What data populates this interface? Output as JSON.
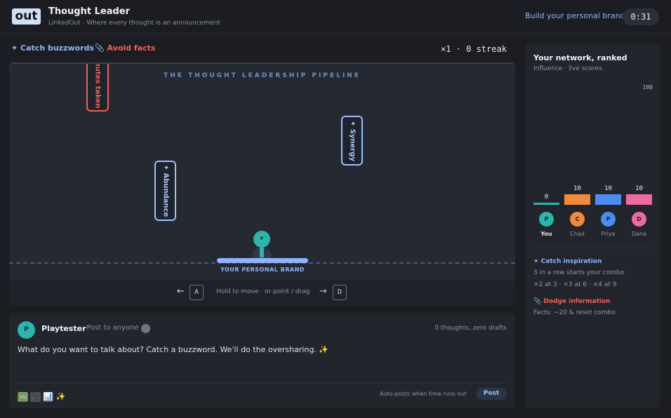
{
  "header": {
    "logo": "out",
    "title": "Thought Leader",
    "subtitle": "LinkedOut · Where every thought is an announcement",
    "brand_link": "Build your personal brand",
    "timer": "0:31"
  },
  "goals": {
    "catch": "✦ Catch buzzwords",
    "separator": "/",
    "avoid": "📎 Avoid facts",
    "streak": "×1 · 0 streak"
  },
  "game": {
    "pipeline_title": "THE THOUGHT LEADERSHIP PIPELINE",
    "falling_words": [
      {
        "text": "nutes taken",
        "kind": "fact"
      },
      {
        "text": "✦ Synergy",
        "kind": "buzzword"
      },
      {
        "text": "✦ Abundance",
        "kind": "buzzword"
      }
    ],
    "player_initial": "P",
    "paddle_label": "YOUR PERSONAL BRAND"
  },
  "controls": {
    "left_arrow": "←",
    "left_key": "A",
    "hint": "Hold to move · or point / drag",
    "right_arrow": "→",
    "right_key": "D"
  },
  "composer": {
    "avatar": "P",
    "name": "Playtester",
    "audience": "· Post to anyone",
    "count": "0 thoughts, zero drafts",
    "prompt": "What do you want to talk about? Catch a buzzword. We'll do the oversharing. ✨",
    "tools": [
      "🖼",
      "🎥",
      "📊",
      "✨"
    ],
    "autopost": "Auto-posts when time runs out",
    "post_label": "Post"
  },
  "sidebar": {
    "title": "Your network, ranked",
    "subtitle": "Influence · live scores",
    "max_label": "100",
    "max_value": 100,
    "players": [
      {
        "initial": "P",
        "name": "You",
        "score": 0,
        "score_label": "0",
        "color": "#2bb5ac"
      },
      {
        "initial": "C",
        "name": "Chad",
        "score": 10,
        "score_label": "10",
        "color": "#f08a3c"
      },
      {
        "initial": "P",
        "name": "Priya",
        "score": 10,
        "score_label": "10",
        "color": "#4b8df0"
      },
      {
        "initial": "D",
        "name": "Dana",
        "score": 10,
        "score_label": "10",
        "color": "#ec6aa3"
      }
    ],
    "rules": {
      "catch_title": "✦ Catch inspiration",
      "catch_line1": "3 in a row starts your combo",
      "catch_line2": "×2 at 3 · ×3 at 6 · ×4 at 9",
      "dodge_title": "📎 Dodge information",
      "dodge_line1": "Facts: −20 & reset combo"
    }
  }
}
